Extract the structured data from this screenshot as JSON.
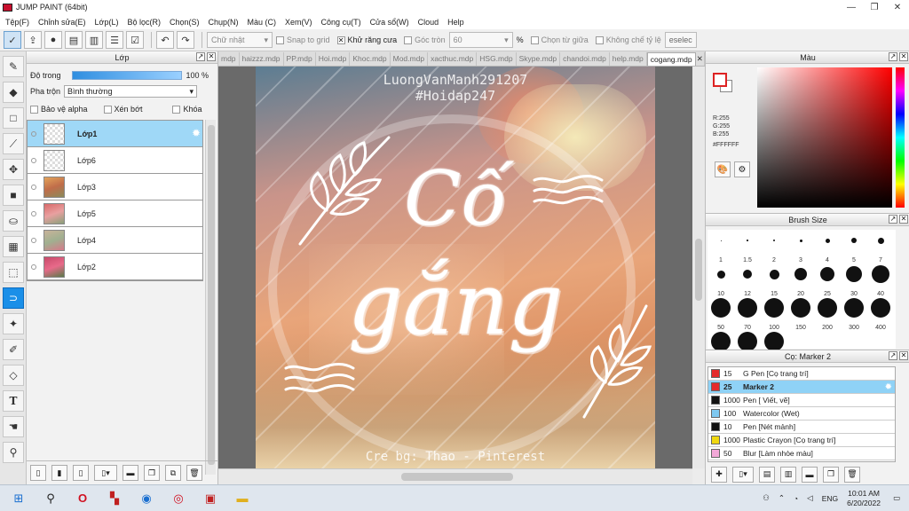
{
  "window": {
    "title": "JUMP PAINT (64bit)",
    "minimize": "—",
    "maximize": "❐",
    "close": "✕"
  },
  "menu": [
    "Tệp(F)",
    "Chỉnh sửa(E)",
    "Lớp(L)",
    "Bộ lọc(R)",
    "Chọn(S)",
    "Chụp(N)",
    "Màu (C)",
    "Xem(V)",
    "Công cụ(T)",
    "Cửa sổ(W)",
    "Cloud",
    "Help"
  ],
  "toolbar": {
    "shape_select": "Chữ nhật",
    "snap_to_grid": "Snap to grid",
    "antialias": "Khử răng cưa",
    "round_corner": "Góc tròn",
    "round_value": "60",
    "percent": "%",
    "select_center": "Chọn từ giữa",
    "fixed_ratio": "Không chế tỷ lệ",
    "deselect": "eselec"
  },
  "layer_panel": {
    "title": "Lớp",
    "opacity_label": "Độ trong",
    "opacity_value": "100 %",
    "blend_label": "Pha trộn",
    "blend_value": "Bình thường",
    "protect_alpha": "Bảo vệ alpha",
    "clipping": "Xén bớt",
    "lock": "Khóa",
    "layers": [
      {
        "name": "Lớp1",
        "active": true
      },
      {
        "name": "Lớp6"
      },
      {
        "name": "Lớp3"
      },
      {
        "name": "Lớp5"
      },
      {
        "name": "Lớp4"
      },
      {
        "name": "Lớp2"
      }
    ]
  },
  "tabs": [
    "mdp",
    "haizzz.mdp",
    "PP.mdp",
    "Hoi.mdp",
    "Khoc.mdp",
    "Mod.mdp",
    "xacthuc.mdp",
    "HSG.mdp",
    "Skype.mdp",
    "chandoi.mdp",
    "help.mdp",
    "cogang.mdp"
  ],
  "active_tab": "cogang.mdp",
  "artwork": {
    "watermark_top1": "LuongVanManh291207",
    "watermark_top2": "#Hoidap247",
    "word1": "Cố",
    "word2": "gắng",
    "credit": "Cre bg: Thao - Pinterest"
  },
  "color_panel": {
    "title": "Màu",
    "r": "R:255",
    "g": "G:255",
    "b": "B:255",
    "hex": "#FFFFFF"
  },
  "brush_panel": {
    "title": "Brush Size",
    "sizes": [
      "1",
      "1.5",
      "2",
      "3",
      "4",
      "5",
      "7",
      "10",
      "12",
      "15",
      "20",
      "25",
      "30",
      "40",
      "50",
      "70",
      "100",
      "150",
      "200",
      "300",
      "400",
      "",
      "",
      ""
    ]
  },
  "marker_panel": {
    "title": "Cọ: Marker 2",
    "items": [
      {
        "size": "15",
        "name": "G Pen [Cọ trang trí]",
        "color": "#e52b2b"
      },
      {
        "size": "25",
        "name": "Marker 2",
        "color": "#e52b2b",
        "active": true
      },
      {
        "size": "1000",
        "name": "Pen [ Viết, vẽ]",
        "color": "#111111"
      },
      {
        "size": "100",
        "name": "Watercolor (Wet)",
        "color": "#7ec8f0"
      },
      {
        "size": "10",
        "name": "Pen [Nét mảnh]",
        "color": "#111111"
      },
      {
        "size": "1000",
        "name": "Plastic Crayon [Cọ trang trí]",
        "color": "#f0d810"
      },
      {
        "size": "50",
        "name": "Blur [Làm nhòe màu]",
        "color": "#f3a8d8"
      }
    ]
  },
  "taskbar": {
    "lang": "ENG",
    "time": "10:01 AM",
    "date": "6/20/2022"
  }
}
